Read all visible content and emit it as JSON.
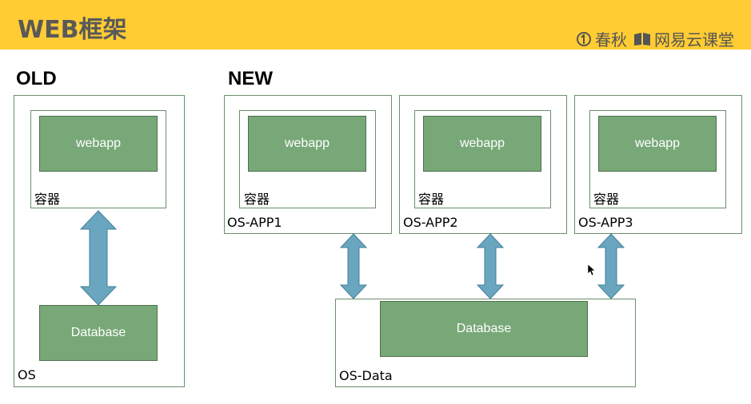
{
  "header": {
    "title": "WEB框架",
    "brand1": "春秋",
    "brand2": "网易云课堂",
    "bg_color": "#ffcc33"
  },
  "old": {
    "label": "OLD",
    "webapp": "webapp",
    "container": "容器",
    "database": "Database",
    "os": "OS"
  },
  "new": {
    "label": "NEW",
    "apps": [
      {
        "webapp": "webapp",
        "container": "容器",
        "os": "OS-APP1"
      },
      {
        "webapp": "webapp",
        "container": "容器",
        "os": "OS-APP2"
      },
      {
        "webapp": "webapp",
        "container": "容器",
        "os": "OS-APP3"
      }
    ],
    "database": "Database",
    "os_data": "OS-Data"
  },
  "colors": {
    "green_fill": "#78a878",
    "arrow_fill": "#6aa6bf",
    "box_border": "#6b8f6b"
  }
}
